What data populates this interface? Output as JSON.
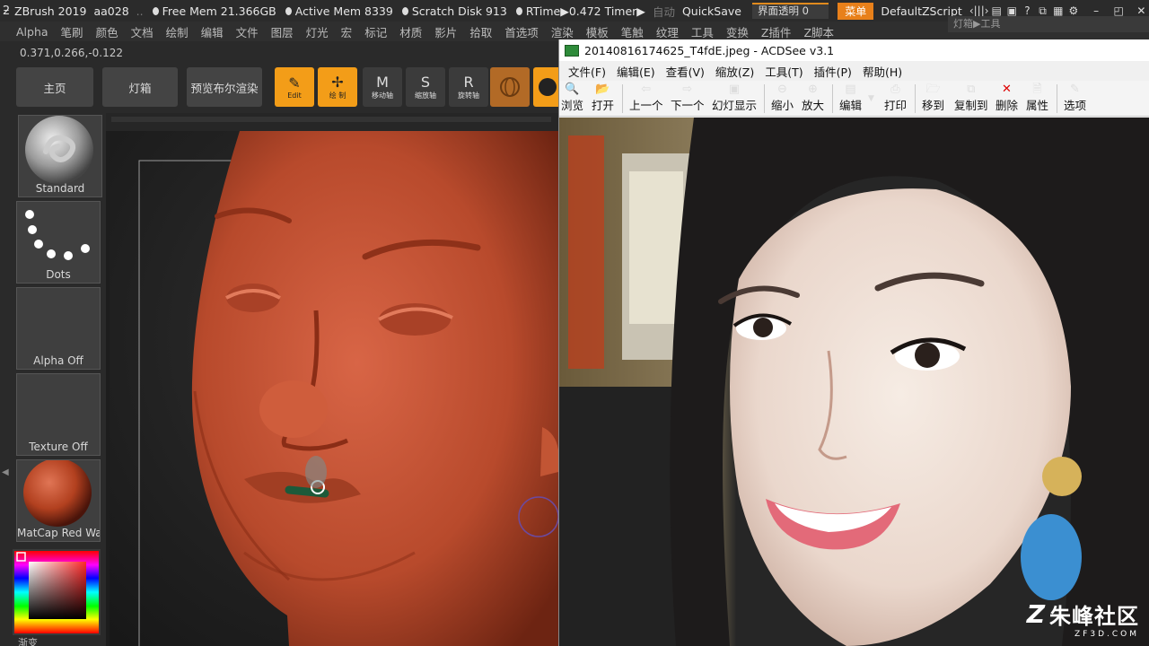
{
  "zbrush": {
    "title": {
      "app": "ZBrush 2019",
      "user": "aa028",
      "ellipsis": "..",
      "free_mem": "Free Mem 21.366GB",
      "active_mem": "Active Mem 8339",
      "scratch_disk": "Scratch Disk 913",
      "rtime": "RTime▶0.472 Timer▶",
      "auto": "自动",
      "quicksave": "QuickSave",
      "transparency_label": "界面透明 0",
      "menu_btn": "菜单",
      "script": "DefaultZScript"
    },
    "menus": [
      "Alpha",
      "笔刷",
      "颜色",
      "文档",
      "绘制",
      "编辑",
      "文件",
      "图层",
      "灯光",
      "宏",
      "标记",
      "材质",
      "影片",
      "拾取",
      "首选项",
      "渲染",
      "模板",
      "笔触",
      "纹理",
      "工具",
      "变换",
      "Z插件",
      "Z脚本"
    ],
    "lightbox_tab": "灯箱▶工具",
    "coordinates": "0.371,0.266,-0.122",
    "shelf": {
      "home": "主页",
      "lightbox": "灯箱",
      "preview_render": "预览布尔渲染",
      "edit": "Edit",
      "draw": "绘 制",
      "move": "移动轴",
      "scale": "缩放轴",
      "rotate": "旋转轴"
    },
    "tray": {
      "brush": "Standard",
      "stroke": "Dots",
      "alpha": "Alpha Off",
      "texture": "Texture Off",
      "material": "MatCap Red Wax",
      "gradient": "渐变"
    }
  },
  "acdsee": {
    "title": "20140816174625_T4fdE.jpeg - ACDSee v3.1",
    "menus": [
      "文件(F)",
      "编辑(E)",
      "查看(V)",
      "缩放(Z)",
      "工具(T)",
      "插件(P)",
      "帮助(H)"
    ],
    "toolbar": [
      "浏览",
      "打开",
      "上一个",
      "下一个",
      "幻灯显示",
      "缩小",
      "放大",
      "编辑",
      "打印",
      "移到",
      "复制到",
      "删除",
      "属性",
      "选项"
    ]
  },
  "watermark": {
    "name": "朱峰社区",
    "url": "ZF3D.COM"
  }
}
